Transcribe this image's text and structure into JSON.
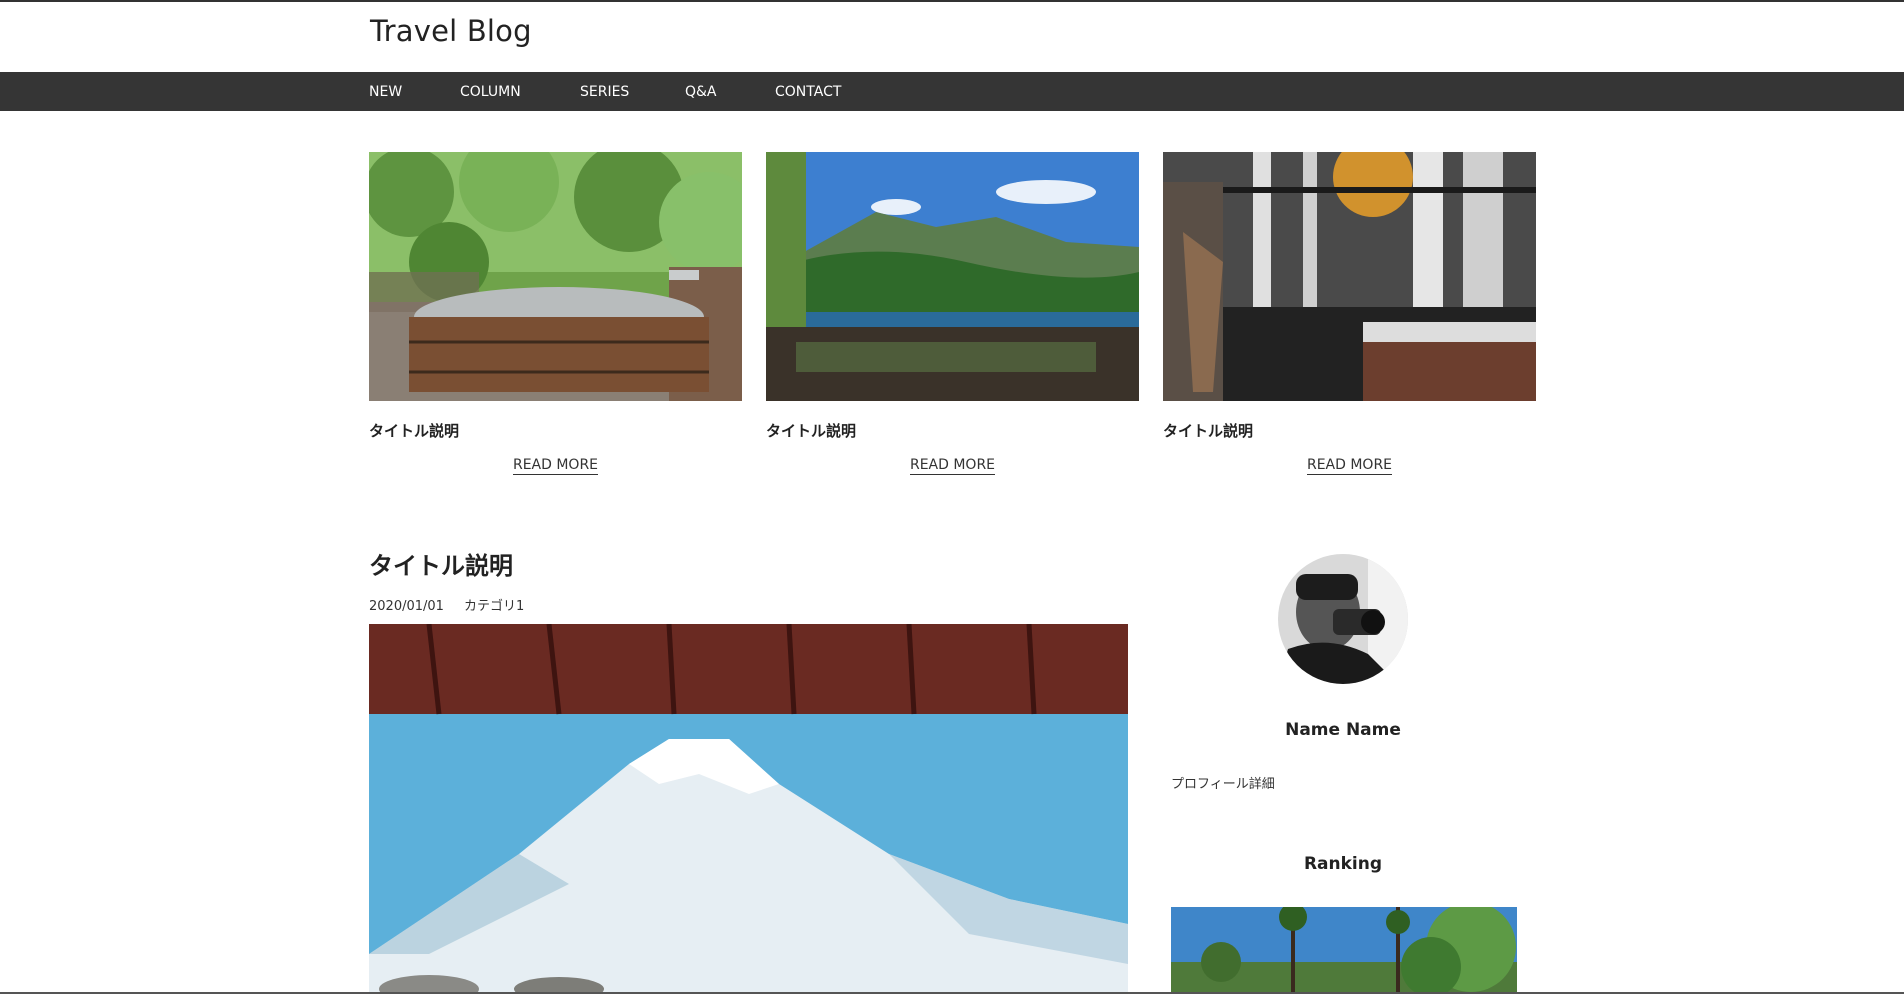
{
  "site": {
    "brand": "Travel Blog"
  },
  "nav": {
    "items": [
      {
        "label": "NEW"
      },
      {
        "label": "COLUMN"
      },
      {
        "label": "SERIES"
      },
      {
        "label": "Q&A"
      },
      {
        "label": "CONTACT"
      }
    ]
  },
  "cards": [
    {
      "title": "タイトル説明",
      "link": "READ MORE"
    },
    {
      "title": "タイトル説明",
      "link": "READ MORE"
    },
    {
      "title": "タイトル説明",
      "link": "READ MORE"
    }
  ],
  "post": {
    "title": "タイトル説明",
    "date": "2020/01/01",
    "category": "カテゴリ1"
  },
  "profile": {
    "name": "Name Name",
    "detail": "プロフィール詳細"
  },
  "ranking": {
    "title": "Ranking"
  },
  "colors": {
    "navbar": "#353535",
    "text": "#222222",
    "background": "#ffffff"
  }
}
